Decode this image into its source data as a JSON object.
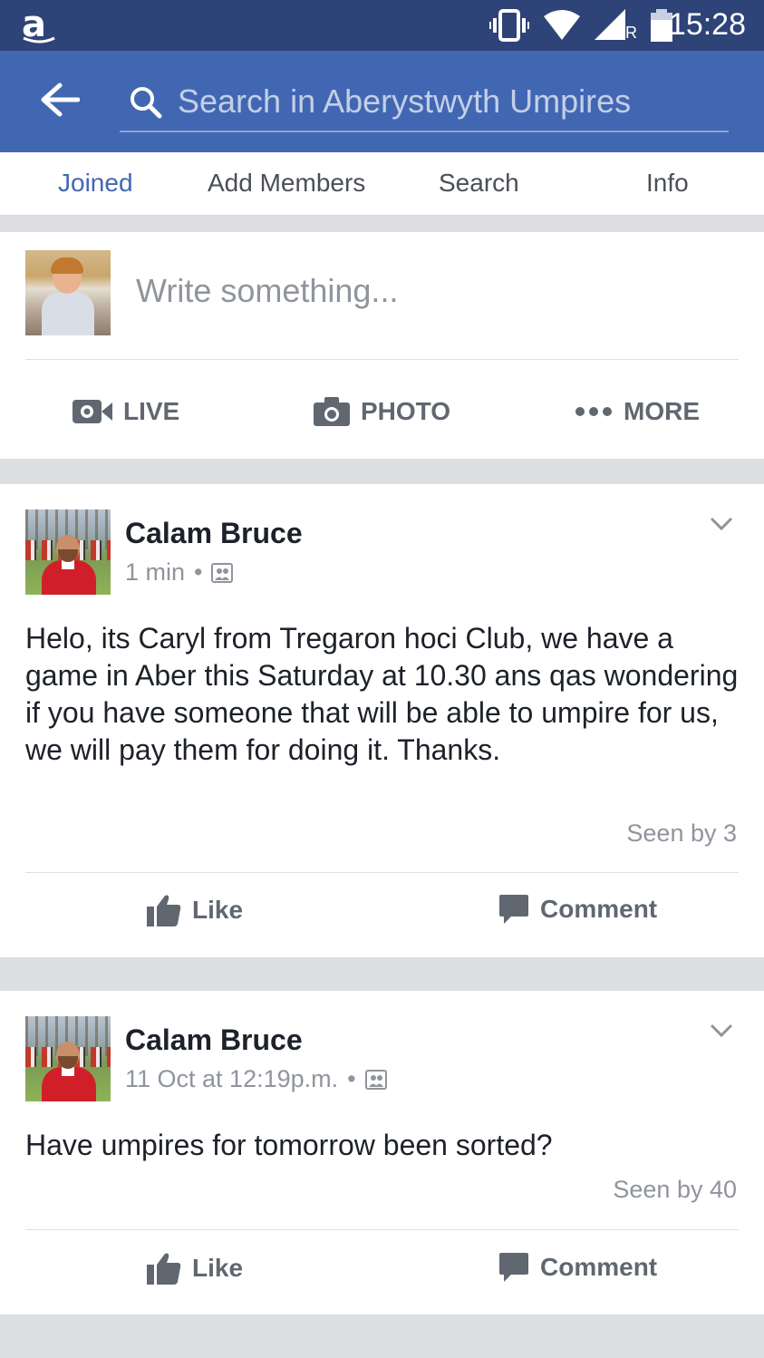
{
  "status_bar": {
    "carrier_logo": "a",
    "time": "15:28",
    "roaming_label": "R",
    "icons": [
      "vibrate-icon",
      "wifi-icon",
      "signal-icon",
      "battery-icon"
    ]
  },
  "header": {
    "search_placeholder": "Search in Aberystwyth Umpires",
    "brand_color": "#4267b2"
  },
  "tabs": [
    {
      "label": "Joined",
      "active": true
    },
    {
      "label": "Add Members",
      "active": false
    },
    {
      "label": "Search",
      "active": false
    },
    {
      "label": "Info",
      "active": false
    }
  ],
  "composer": {
    "placeholder": "Write something...",
    "actions": [
      {
        "label": "LIVE",
        "icon": "video-camera-icon"
      },
      {
        "label": "PHOTO",
        "icon": "camera-icon"
      },
      {
        "label": "MORE",
        "icon": "more-dots-icon"
      }
    ]
  },
  "posts": [
    {
      "author": "Calam Bruce",
      "time": "1 min",
      "audience_icon": "group-icon",
      "body": "Helo, its Caryl from Tregaron hoci Club, we have a game in Aber this Saturday at 10.30 ans qas wondering if you have someone that will be able to umpire for us, we will pay them for doing it. Thanks.",
      "seen": "Seen by 3",
      "like_label": "Like",
      "comment_label": "Comment"
    },
    {
      "author": "Calam Bruce",
      "time": "11 Oct at 12:19p.m.",
      "audience_icon": "group-icon",
      "body": "Have umpires for tomorrow been sorted?",
      "seen": "Seen by 40",
      "like_label": "Like",
      "comment_label": "Comment"
    }
  ]
}
